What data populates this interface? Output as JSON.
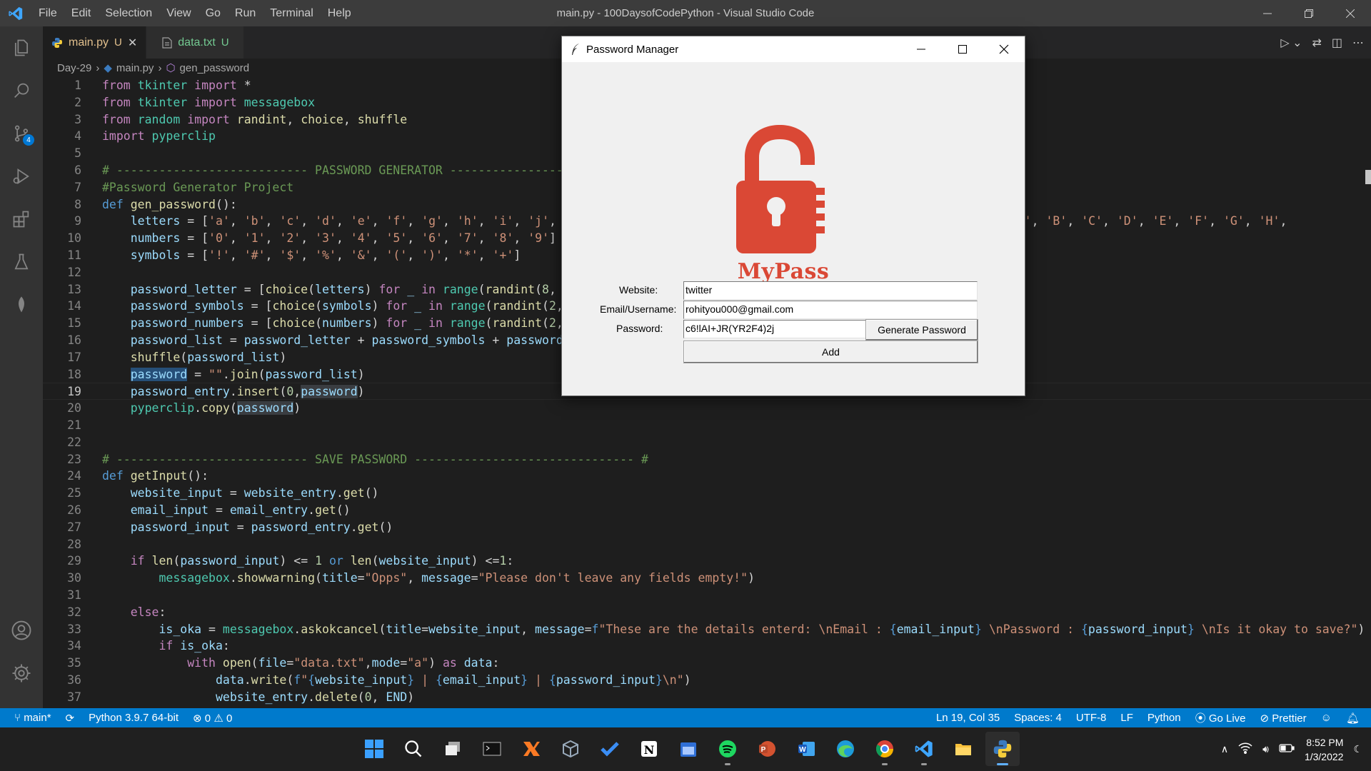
{
  "window": {
    "title": "main.py - 100DaysofCodePython - Visual Studio Code",
    "menu": [
      "File",
      "Edit",
      "Selection",
      "View",
      "Go",
      "Run",
      "Terminal",
      "Help"
    ]
  },
  "tabs": [
    {
      "label": "main.py",
      "status": "U",
      "active": true
    },
    {
      "label": "data.txt",
      "status": "U",
      "active": false
    }
  ],
  "breadcrumb": [
    "Day-29",
    "main.py",
    "gen_password"
  ],
  "activity_badge": "4",
  "editor": {
    "current_line": 19,
    "lines": [
      {
        "n": 1,
        "html": "<span class='kw'>from</span> <span class='cls'>tkinter</span> <span class='kw'>import</span> *"
      },
      {
        "n": 2,
        "html": "<span class='kw'>from</span> <span class='cls'>tkinter</span> <span class='kw'>import</span> <span class='cls'>messagebox</span>"
      },
      {
        "n": 3,
        "html": "<span class='kw'>from</span> <span class='cls'>random</span> <span class='kw'>import</span> <span class='fn'>randint</span>, <span class='fn'>choice</span>, <span class='fn'>shuffle</span>"
      },
      {
        "n": 4,
        "html": "<span class='kw'>import</span> <span class='cls'>pyperclip</span>"
      },
      {
        "n": 5,
        "html": ""
      },
      {
        "n": 6,
        "html": "<span class='cmt'># --------------------------- PASSWORD GENERATOR ------------------</span>"
      },
      {
        "n": 7,
        "html": "<span class='cmt'>#Password Generator Project</span>"
      },
      {
        "n": 8,
        "html": "<span class='kw2'>def</span> <span class='fn'>gen_password</span>():"
      },
      {
        "n": 9,
        "html": "    <span class='var'>letters</span> = [<span class='str'>'a'</span>, <span class='str'>'b'</span>, <span class='str'>'c'</span>, <span class='str'>'d'</span>, <span class='str'>'e'</span>, <span class='str'>'f'</span>, <span class='str'>'g'</span>, <span class='str'>'h'</span>, <span class='str'>'i'</span>, <span class='str'>'j'</span>, <span class='str'>'k'</span>                                                  <span class='str'>'y'</span>, <span class='str'>'z'</span>, <span class='str'>'A'</span>, <span class='str'>'B'</span>, <span class='str'>'C'</span>, <span class='str'>'D'</span>, <span class='str'>'E'</span>, <span class='str'>'F'</span>, <span class='str'>'G'</span>, <span class='str'>'H'</span>,"
      },
      {
        "n": 10,
        "html": "    <span class='var'>numbers</span> = [<span class='str'>'0'</span>, <span class='str'>'1'</span>, <span class='str'>'2'</span>, <span class='str'>'3'</span>, <span class='str'>'4'</span>, <span class='str'>'5'</span>, <span class='str'>'6'</span>, <span class='str'>'7'</span>, <span class='str'>'8'</span>, <span class='str'>'9'</span>]"
      },
      {
        "n": 11,
        "html": "    <span class='var'>symbols</span> = [<span class='str'>'!'</span>, <span class='str'>'#'</span>, <span class='str'>'$'</span>, <span class='str'>'%'</span>, <span class='str'>'&amp;'</span>, <span class='str'>'('</span>, <span class='str'>')'</span>, <span class='str'>'*'</span>, <span class='str'>'+'</span>]"
      },
      {
        "n": 12,
        "html": ""
      },
      {
        "n": 13,
        "html": "    <span class='var'>password_letter</span> = [<span class='fn'>choice</span>(<span class='var'>letters</span>) <span class='kw'>for</span> <span class='var'>_</span> <span class='kw'>in</span> <span class='cls'>range</span>(<span class='fn'>randint</span>(<span class='num'>8</span>, <span class='num'>10</span>"
      },
      {
        "n": 14,
        "html": "    <span class='var'>password_symbols</span> = [<span class='fn'>choice</span>(<span class='var'>symbols</span>) <span class='kw'>for</span> <span class='var'>_</span> <span class='kw'>in</span> <span class='cls'>range</span>(<span class='fn'>randint</span>(<span class='num'>2</span>, <span class='num'>4</span>"
      },
      {
        "n": 15,
        "html": "    <span class='var'>password_numbers</span> = [<span class='fn'>choice</span>(<span class='var'>numbers</span>) <span class='kw'>for</span> <span class='var'>_</span> <span class='kw'>in</span> <span class='cls'>range</span>(<span class='fn'>randint</span>(<span class='num'>2</span>, <span class='num'>4</span>"
      },
      {
        "n": 16,
        "html": "    <span class='var'>password_list</span> = <span class='var'>password_letter</span> + <span class='var'>password_symbols</span> + <span class='var'>password_n</span>"
      },
      {
        "n": 17,
        "html": "    <span class='fn'>shuffle</span>(<span class='var'>password_list</span>)"
      },
      {
        "n": 18,
        "html": "    <span class='var hl'>password</span> = <span class='str'>\"\"</span>.<span class='fn'>join</span>(<span class='var'>password_list</span>)"
      },
      {
        "n": 19,
        "html": "    <span class='var'>password_entry</span>.<span class='fn'>insert</span>(<span class='num'>0</span>,<span class='var hl2'>password</span>)"
      },
      {
        "n": 20,
        "html": "    <span class='cls'>pyperclip</span>.<span class='fn'>copy</span>(<span class='var hl2'>password</span>)"
      },
      {
        "n": 21,
        "html": ""
      },
      {
        "n": 22,
        "html": ""
      },
      {
        "n": 23,
        "html": "<span class='cmt'># --------------------------- SAVE PASSWORD ------------------------------- #</span>"
      },
      {
        "n": 24,
        "html": "<span class='kw2'>def</span> <span class='fn'>getInput</span>():"
      },
      {
        "n": 25,
        "html": "    <span class='var'>website_input</span> = <span class='var'>website_entry</span>.<span class='fn'>get</span>()"
      },
      {
        "n": 26,
        "html": "    <span class='var'>email_input</span> = <span class='var'>email_entry</span>.<span class='fn'>get</span>()"
      },
      {
        "n": 27,
        "html": "    <span class='var'>password_input</span> = <span class='var'>password_entry</span>.<span class='fn'>get</span>()"
      },
      {
        "n": 28,
        "html": ""
      },
      {
        "n": 29,
        "html": "    <span class='kw'>if</span> <span class='fn'>len</span>(<span class='var'>password_input</span>) &lt;= <span class='num'>1</span> <span class='kw2'>or</span> <span class='fn'>len</span>(<span class='var'>website_input</span>) &lt;=<span class='num'>1</span>:"
      },
      {
        "n": 30,
        "html": "        <span class='cls'>messagebox</span>.<span class='fn'>showwarning</span>(<span class='var'>title</span>=<span class='str'>\"Opps\"</span>, <span class='var'>message</span>=<span class='str'>\"Please don't leave any fields empty!\"</span>)"
      },
      {
        "n": 31,
        "html": ""
      },
      {
        "n": 32,
        "html": "    <span class='kw'>else</span>:"
      },
      {
        "n": 33,
        "html": "        <span class='var'>is_oka</span> = <span class='cls'>messagebox</span>.<span class='fn'>askokcancel</span>(<span class='var'>title</span>=<span class='var'>website_input</span>, <span class='var'>message</span>=<span class='kw2'>f</span><span class='str'>\"These are the details enterd: \\nEmail : </span><span class='kw2'>{</span><span class='var'>email_input</span><span class='kw2'>}</span><span class='str'> \\nPassword : </span><span class='kw2'>{</span><span class='var'>password_input</span><span class='kw2'>}</span><span class='str'> \\nIs it okay to save?\"</span>)"
      },
      {
        "n": 34,
        "html": "        <span class='kw'>if</span> <span class='var'>is_oka</span>:"
      },
      {
        "n": 35,
        "html": "            <span class='kw'>with</span> <span class='fn'>open</span>(<span class='var'>file</span>=<span class='str'>\"data.txt\"</span>,<span class='var'>mode</span>=<span class='str'>\"a\"</span>) <span class='kw'>as</span> <span class='var'>data</span>:"
      },
      {
        "n": 36,
        "html": "                <span class='var'>data</span>.<span class='fn'>write</span>(<span class='kw2'>f</span><span class='str'>\"</span><span class='kw2'>{</span><span class='var'>website_input</span><span class='kw2'>}</span><span class='str'> | </span><span class='kw2'>{</span><span class='var'>email_input</span><span class='kw2'>}</span><span class='str'> | </span><span class='kw2'>{</span><span class='var'>password_input</span><span class='kw2'>}</span><span class='str'>\\n\"</span>)"
      },
      {
        "n": 37,
        "html": "                <span class='var'>website_entry</span>.<span class='fn'>delete</span>(<span class='num'>0</span>, <span class='var'>END</span>)"
      }
    ]
  },
  "statusbar": {
    "branch": "main*",
    "python": "Python 3.9.7 64-bit",
    "problems": "0",
    "warnings": "0",
    "cursor": "Ln 19, Col 35",
    "spaces": "Spaces: 4",
    "encoding": "UTF-8",
    "eol": "LF",
    "language": "Python",
    "golive": "Go Live",
    "prettier": "Prettier"
  },
  "tkinter": {
    "title": "Password Manager",
    "logo_text": "MyPass",
    "labels": {
      "website": "Website:",
      "email": "Email/Username:",
      "password": "Password:"
    },
    "values": {
      "website": "twitter",
      "email": "rohityou000@gmail.com",
      "password": "c6!lAI+JR(YR2F4)2j"
    },
    "buttons": {
      "generate": "Generate Password",
      "add": "Add"
    },
    "logo_color": "#da4835"
  },
  "clock": {
    "time": "8:52 PM",
    "date": "1/3/2022"
  },
  "colors": {
    "statusbar": "#007acc",
    "titlebar": "#3c3c3c",
    "editor_bg": "#1e1e1e"
  }
}
